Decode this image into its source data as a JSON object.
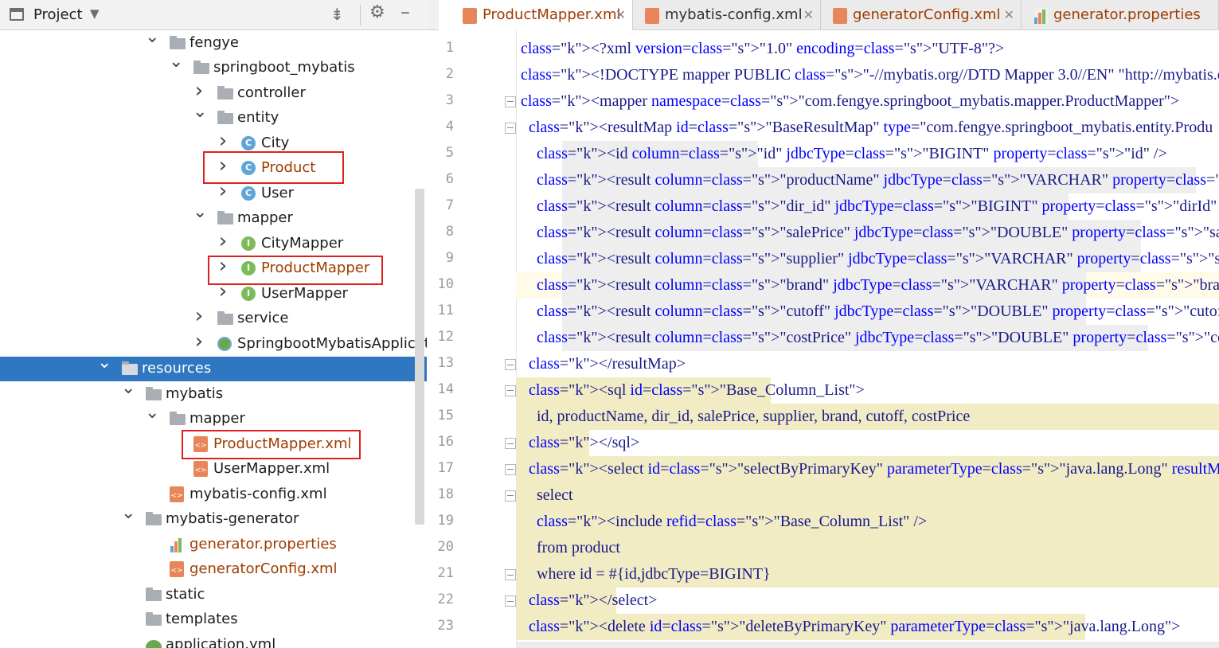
{
  "project_panel": {
    "title": "Project",
    "tree": [
      {
        "label": "fengye",
        "icon": "folder-icon",
        "expanded": true
      },
      {
        "label": "springboot_mybatis",
        "icon": "folder-icon",
        "expanded": true
      },
      {
        "label": "controller",
        "icon": "folder-icon",
        "expanded": false
      },
      {
        "label": "entity",
        "icon": "folder-icon",
        "expanded": true
      },
      {
        "label": "City",
        "icon": "class-icon",
        "icon_letter": "C"
      },
      {
        "label": "Product",
        "icon": "class-icon",
        "icon_letter": "C"
      },
      {
        "label": "User",
        "icon": "class-icon",
        "icon_letter": "C"
      },
      {
        "label": "mapper",
        "icon": "folder-icon",
        "expanded": true
      },
      {
        "label": "CityMapper",
        "icon": "interface-icon",
        "icon_letter": "I"
      },
      {
        "label": "ProductMapper",
        "icon": "interface-icon",
        "icon_letter": "I"
      },
      {
        "label": "UserMapper",
        "icon": "interface-icon",
        "icon_letter": "I"
      },
      {
        "label": "service",
        "icon": "folder-icon",
        "expanded": false
      },
      {
        "label": "SpringbootMybatisApplicat",
        "icon": "spring-boot-icon"
      },
      {
        "label": "resources",
        "icon": "resources-folder-icon",
        "expanded": true,
        "selected": true
      },
      {
        "label": "mybatis",
        "icon": "folder-icon",
        "expanded": true
      },
      {
        "label": "mapper",
        "icon": "folder-icon",
        "expanded": true
      },
      {
        "label": "ProductMapper.xml",
        "icon": "xml-file-icon"
      },
      {
        "label": "UserMapper.xml",
        "icon": "xml-file-icon"
      },
      {
        "label": "mybatis-config.xml",
        "icon": "xml-file-icon"
      },
      {
        "label": "mybatis-generator",
        "icon": "folder-icon",
        "expanded": true
      },
      {
        "label": "generator.properties",
        "icon": "properties-file-icon"
      },
      {
        "label": "generatorConfig.xml",
        "icon": "xml-file-icon"
      },
      {
        "label": "static",
        "icon": "folder-icon"
      },
      {
        "label": "templates",
        "icon": "folder-icon"
      },
      {
        "label": "application.yml",
        "icon": "yml-file-icon"
      }
    ]
  },
  "editor": {
    "tabs": [
      {
        "label": "ProductMapper.xml",
        "active": true
      },
      {
        "label": "mybatis-config.xml",
        "active": false
      },
      {
        "label": "generatorConfig.xml",
        "active": false
      },
      {
        "label": "generator.properties",
        "active": false
      }
    ],
    "line_numbers": [
      "1",
      "2",
      "3",
      "4",
      "5",
      "6",
      "7",
      "8",
      "9",
      "10",
      "11",
      "12",
      "13",
      "14",
      "15",
      "16",
      "17",
      "18",
      "19",
      "20",
      "21",
      "22",
      "23"
    ],
    "code_lines": [
      "<?xml version=\"1.0\" encoding=\"UTF-8\"?>",
      "<!DOCTYPE mapper PUBLIC \"-//mybatis.org//DTD Mapper 3.0//EN\" \"http://mybatis.org",
      "<mapper namespace=\"com.fengye.springboot_mybatis.mapper.ProductMapper\">",
      "  <resultMap id=\"BaseResultMap\" type=\"com.fengye.springboot_mybatis.entity.Produ",
      "    <id column=\"id\" jdbcType=\"BIGINT\" property=\"id\" />",
      "    <result column=\"productName\" jdbcType=\"VARCHAR\" property=\"productname\" />",
      "    <result column=\"dir_id\" jdbcType=\"BIGINT\" property=\"dirId\" />",
      "    <result column=\"salePrice\" jdbcType=\"DOUBLE\" property=\"saleprice\" />",
      "    <result column=\"supplier\" jdbcType=\"VARCHAR\" property=\"supplier\" />",
      "    <result column=\"brand\" jdbcType=\"VARCHAR\" property=\"brand\" />",
      "    <result column=\"cutoff\" jdbcType=\"DOUBLE\" property=\"cutoff\" />",
      "    <result column=\"costPrice\" jdbcType=\"DOUBLE\" property=\"costprice\" />",
      "  </resultMap>",
      "  <sql id=\"Base_Column_List\">",
      "    id, productName, dir_id, salePrice, supplier, brand, cutoff, costPrice",
      "  </sql>",
      "  <select id=\"selectByPrimaryKey\" parameterType=\"java.lang.Long\" resultMap=\"Base",
      "    select",
      "    <include refid=\"Base_Column_List\" />",
      "    from product",
      "    where id = #{id,jdbcType=BIGINT}",
      "  </select>",
      "  <delete id=\"deleteByPrimaryKey\" parameterType=\"java.lang.Long\">"
    ]
  }
}
